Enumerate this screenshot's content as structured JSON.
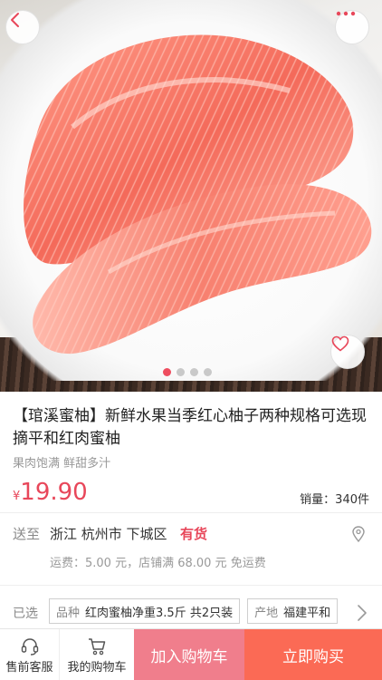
{
  "nav": {
    "back_icon": "chevron-left-icon",
    "more_icon": "more-horizontal-icon"
  },
  "gallery": {
    "image": "pomelo-flesh-photo",
    "favorite_icon": "heart-icon",
    "dots_total": 4,
    "dots_active": 1
  },
  "product": {
    "title": "【琯溪蜜柚】新鲜水果当季红心柚子两种规格可选现摘平和红肉蜜柚",
    "subtitle": "果肉饱满 鲜甜多汁",
    "currency": "¥",
    "price": "19.90",
    "sales": "销量：340件"
  },
  "shipping": {
    "label": "送至",
    "location": "浙江 杭州市 下城区",
    "stock": "有货",
    "freight": "运费：5.00 元，店铺满 68.00 元 免运费",
    "location_icon": "location-pin-icon"
  },
  "selection": {
    "label": "已选",
    "specs": [
      {
        "key": "品种",
        "value": "红肉蜜柚净重3.5斤 共2只装"
      },
      {
        "key": "产地",
        "value": "福建平和"
      }
    ],
    "arrow_icon": "chevron-right-icon"
  },
  "bottombar": {
    "service_label": "售前客服",
    "service_icon": "headset-icon",
    "cart_label": "我的购物车",
    "cart_icon": "cart-icon",
    "add_to_cart": "加入购物车",
    "buy_now": "立即购买"
  },
  "colors": {
    "accent": "#e8475a",
    "add_to_cart_bg": "#f07e8c",
    "buy_now_bg": "#fb6a55"
  }
}
